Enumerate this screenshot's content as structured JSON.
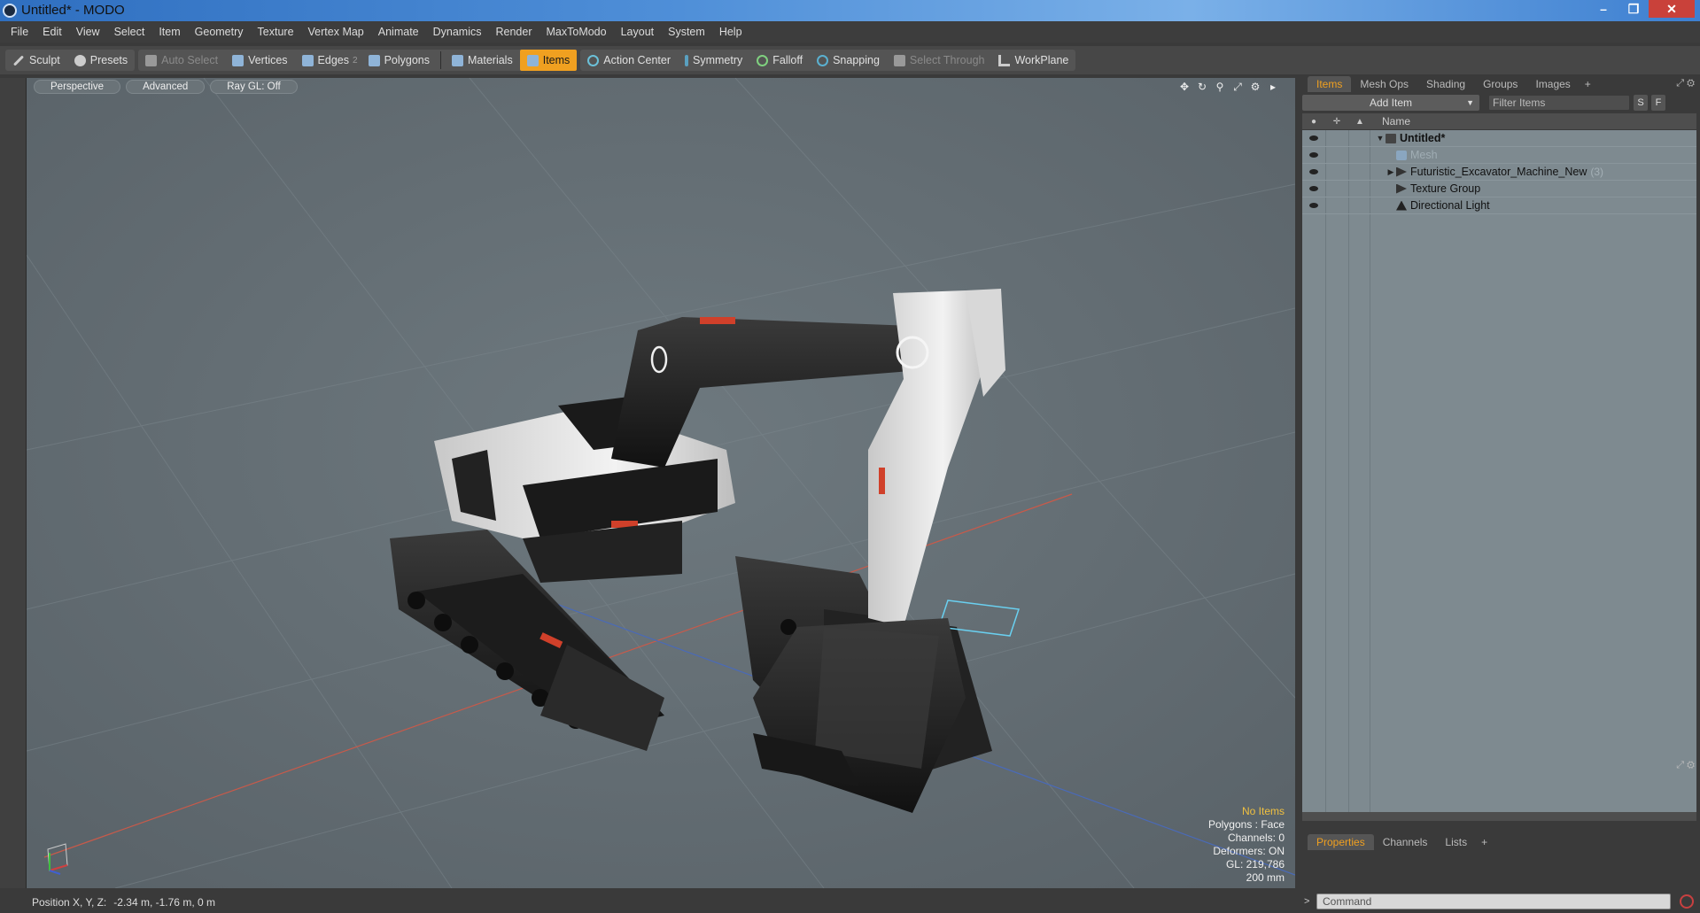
{
  "window": {
    "title": "Untitled* - MODO",
    "controls": [
      "–",
      "❐",
      "✕"
    ]
  },
  "menu": [
    "File",
    "Edit",
    "View",
    "Select",
    "Item",
    "Geometry",
    "Texture",
    "Vertex Map",
    "Animate",
    "Dynamics",
    "Render",
    "MaxToModo",
    "Layout",
    "System",
    "Help"
  ],
  "toolbar": {
    "sculpt": "Sculpt",
    "presets": "Presets",
    "auto_select": "Auto Select",
    "vertices": "Vertices",
    "edges": "Edges",
    "edges_count": "2",
    "polygons": "Polygons",
    "materials": "Materials",
    "items": "Items",
    "action_center": "Action Center",
    "symmetry": "Symmetry",
    "falloff": "Falloff",
    "snapping": "Snapping",
    "select_through": "Select Through",
    "workplane": "WorkPlane"
  },
  "viewport": {
    "tabs": [
      "Perspective",
      "Advanced",
      "Ray GL: Off"
    ],
    "stats": {
      "selection": "No Items",
      "polygons": "Polygons : Face",
      "channels": "Channels: 0",
      "deformers": "Deformers: ON",
      "gl": "GL: 219,786",
      "grid": "200 mm"
    }
  },
  "statusbar": {
    "position_label": "Position X, Y, Z:",
    "position_value": "-2.34 m, -1.76 m, 0 m"
  },
  "items_panel": {
    "tabs": [
      "Items",
      "Mesh Ops",
      "Shading",
      "Groups",
      "Images"
    ],
    "add_item": "Add Item",
    "filter_placeholder": "Filter Items",
    "btn_s": "S",
    "btn_f": "F",
    "column_name": "Name",
    "rows": [
      {
        "label": "Untitled*",
        "count": ""
      },
      {
        "label": "Mesh",
        "count": ""
      },
      {
        "label": "Futuristic_Excavator_Machine_New",
        "count": "(3)"
      },
      {
        "label": "Texture Group",
        "count": ""
      },
      {
        "label": "Directional Light",
        "count": ""
      }
    ]
  },
  "properties_panel": {
    "tabs": [
      "Properties",
      "Channels",
      "Lists"
    ]
  },
  "command": {
    "prompt": ">",
    "placeholder": "Command"
  },
  "colors": {
    "accent": "#f0a020",
    "viewport_bg": "#5f6a70",
    "tree_bg": "#7e8a90"
  }
}
